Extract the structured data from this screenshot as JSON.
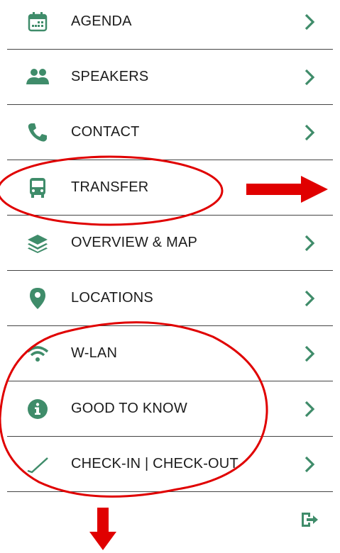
{
  "menu": {
    "items": [
      {
        "label": "AGENDA",
        "icon": "calendar-icon"
      },
      {
        "label": "SPEAKERS",
        "icon": "people-icon"
      },
      {
        "label": "CONTACT",
        "icon": "phone-icon"
      },
      {
        "label": "TRANSFER",
        "icon": "bus-icon"
      },
      {
        "label": "OVERVIEW & MAP",
        "icon": "layers-icon"
      },
      {
        "label": "LOCATIONS",
        "icon": "location-pin-icon"
      },
      {
        "label": "W-LAN",
        "icon": "wifi-icon"
      },
      {
        "label": "GOOD TO KNOW",
        "icon": "info-icon"
      },
      {
        "label": "CHECK-IN | CHECK-OUT",
        "icon": "checkmark-icon"
      }
    ]
  },
  "footer": {
    "logout_icon": "logout-icon"
  },
  "colors": {
    "accent_green": "#3f8c6a",
    "annotation_red": "#e00000",
    "text": "#1c1c1c",
    "divider": "#444444"
  }
}
